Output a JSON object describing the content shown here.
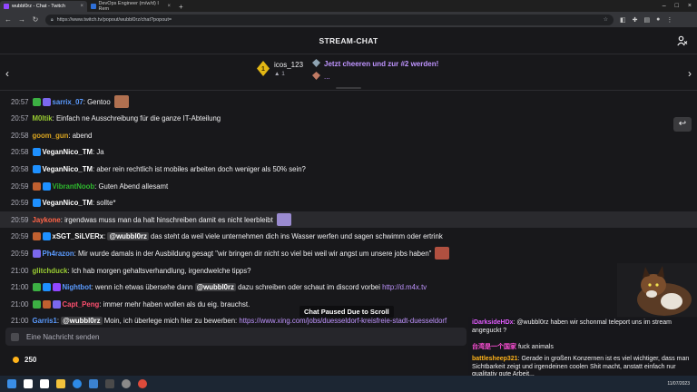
{
  "browser": {
    "tabs": [
      {
        "title": "wubbl0rz - Chat - Twitch",
        "active": true,
        "color": "#9147ff"
      },
      {
        "title": "DevOps Engineer (m/w/d) I Rem",
        "active": false,
        "color": "#2f6fd6"
      }
    ],
    "url": "https://www.twitch.tv/popout/wubbl0rz/chat?popout="
  },
  "header": {
    "title": "STREAM-CHAT"
  },
  "leaderboard": {
    "top_user": "icos_123",
    "top_rank": "1",
    "cheer_text": "Jetzt cheeren und zur #2 werden!",
    "cheer_sub": "..."
  },
  "colors": {
    "accent": "#bf94ff",
    "bg": "#18181b"
  },
  "messages": [
    {
      "time": "20:57",
      "badges": [
        "#3cb043",
        "#7b68ee"
      ],
      "user": "sarrix_07",
      "color": "#5b9bff",
      "parts": [
        {
          "t": ": Gentoo"
        }
      ],
      "emote": "#b07050"
    },
    {
      "time": "20:57",
      "badges": [],
      "user": "M0ltik",
      "color": "#9acd32",
      "parts": [
        {
          "t": ": Einfach ne Ausschreibung für die ganze IT-Abteilung"
        }
      ]
    },
    {
      "time": "20:58",
      "badges": [],
      "user": "goom_gun",
      "color": "#daa520",
      "parts": [
        {
          "t": ": abend"
        }
      ]
    },
    {
      "time": "20:58",
      "badges": [
        "#1e90ff"
      ],
      "user": "VeganNico_TM",
      "color": "#ffffff",
      "parts": [
        {
          "t": ": Ja"
        }
      ]
    },
    {
      "time": "20:58",
      "badges": [
        "#1e90ff"
      ],
      "user": "VeganNico_TM",
      "color": "#ffffff",
      "parts": [
        {
          "t": ": aber rein rechtlich ist mobiles arbeiten doch weniger als 50% sein?"
        }
      ]
    },
    {
      "time": "20:59",
      "badges": [
        "#c06030",
        "#1e90ff"
      ],
      "user": "VibrantNoob",
      "color": "#2eb82e",
      "parts": [
        {
          "t": ": Guten Abend allesamt"
        }
      ]
    },
    {
      "time": "20:59",
      "badges": [
        "#1e90ff"
      ],
      "user": "VeganNico_TM",
      "color": "#ffffff",
      "parts": [
        {
          "t": ": sollte*"
        }
      ]
    },
    {
      "time": "20:59",
      "badges": [],
      "user": "Jaykone",
      "color": "#ff6347",
      "parts": [
        {
          "t": ": irgendwas muss man da halt hinschreiben damit es nicht leerbleibt"
        }
      ],
      "emote": "#9a8bd0",
      "hl": true
    },
    {
      "time": "20:59",
      "badges": [
        "#c06030",
        "#1e90ff"
      ],
      "user": "xSGT_SiLVERx",
      "color": "#ffffff",
      "parts": [
        {
          "t": ": "
        },
        {
          "m": "@wubbl0rz"
        },
        {
          "t": " das steht da weil viele unternehmen dich ins Wasser werfen und sagen schwimm oder ertrink"
        }
      ]
    },
    {
      "time": "20:59",
      "badges": [
        "#7b68ee"
      ],
      "user": "Ph4razon",
      "color": "#5b9bff",
      "parts": [
        {
          "t": ": Mir wurde damals in der Ausbildung gesagt \"wir bringen dir nicht so viel bei weil wir angst um unsere jobs haben\""
        }
      ],
      "emote": "#b05040"
    },
    {
      "time": "21:00",
      "badges": [],
      "user": "glitchduck",
      "color": "#9acd32",
      "parts": [
        {
          "t": ": Ich hab morgen gehaltsverhandlung, irgendwelche tipps?"
        }
      ]
    },
    {
      "time": "21:00",
      "badges": [
        "#3cb043",
        "#1e90ff",
        "#9147ff"
      ],
      "user": "Nightbot",
      "color": "#5b9bff",
      "parts": [
        {
          "t": ": wenn ich etwas übersehe dann "
        },
        {
          "m": "@wubbl0rz"
        },
        {
          "t": " dazu schreiben oder schaut im discord vorbei "
        },
        {
          "l": "http://d.m4x.tv"
        }
      ]
    },
    {
      "time": "21:00",
      "badges": [
        "#3cb043",
        "#c06030",
        "#7b68ee"
      ],
      "user": "Capt_Peng",
      "color": "#ff4f6f",
      "parts": [
        {
          "t": ": immer mehr haben wollen als du eig. brauchst."
        }
      ]
    },
    {
      "time": "21:00",
      "badges": [],
      "user": "Garris1",
      "color": "#5b9bff",
      "parts": [
        {
          "t": ": "
        },
        {
          "m": "@wubbl0rz"
        },
        {
          "t": " Moin, ich überlege mich hier zu bewerben: "
        },
        {
          "l": "https://www.xing.com/jobs/duesseldorf-kreisfreie-stadt-duesseldorf"
        }
      ]
    }
  ],
  "paused_label": "Chat Paused Due to Scroll",
  "input": {
    "placeholder": "Eine Nachricht senden"
  },
  "points": {
    "value": "250"
  },
  "overlay": {
    "lines": [
      {
        "user": "iDarksideHDx",
        "color": "#e35dff",
        "text": ": @wubbl0rz haben wir schonmal teleport uns im stream angeguckt ?"
      },
      {
        "user": "台湾是一个国家",
        "color": "#ff4fd8",
        "text": " fuck animals"
      },
      {
        "user": "battlesheep321",
        "color": "#ffb31a",
        "text": ": Gerade in großen Konzernen ist es viel wichtiger, dass man Sichtbarkeit zeigt und irgendeinen coolen Shit macht, anstatt einfach nur qualitativ gute Arbeit..."
      }
    ]
  },
  "taskbar": {
    "date": "11/07/2023"
  }
}
